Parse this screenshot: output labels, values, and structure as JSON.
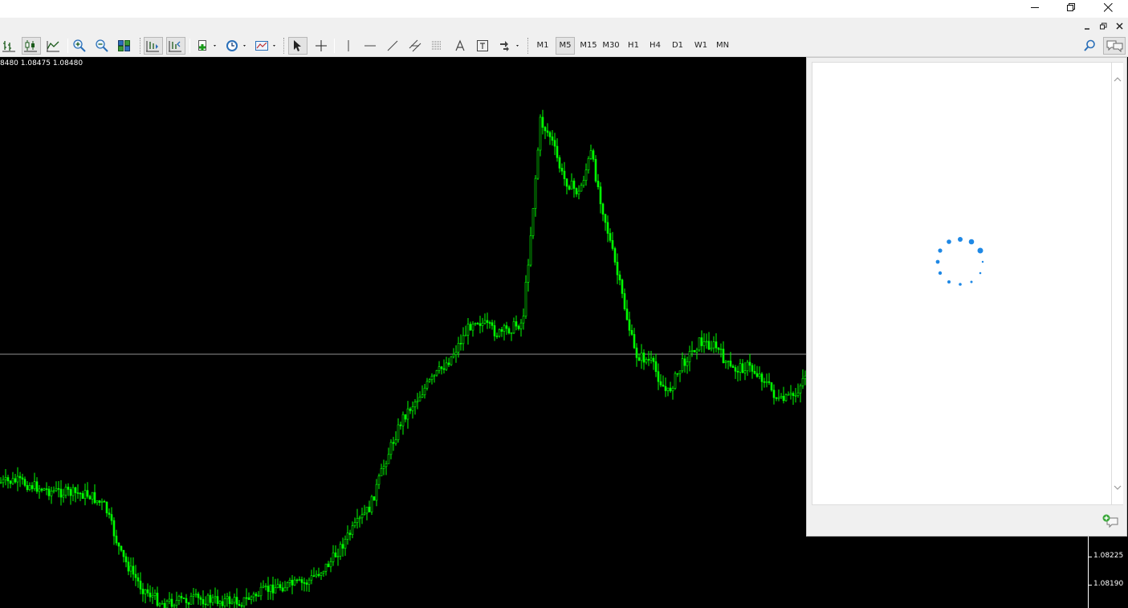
{
  "window": {
    "controls": [
      "minimize-icon",
      "restore-icon",
      "close-icon"
    ]
  },
  "mdi_controls": [
    "mdi-minimize-icon",
    "mdi-restore-icon",
    "mdi-close-icon"
  ],
  "toolbar": {
    "timeframes": [
      "M1",
      "M5",
      "M15",
      "M30",
      "H1",
      "H4",
      "D1",
      "W1",
      "MN"
    ],
    "active_timeframe": "M5",
    "tools": [
      "bar-chart-icon",
      "candlestick-chart-icon",
      "line-chart-icon",
      "zoom-in-icon",
      "zoom-out-icon",
      "tile-windows-icon",
      "autoscroll-icon",
      "chart-shift-icon",
      "indicators-icon",
      "periodicity-icon",
      "templates-icon",
      "cursor-icon",
      "crosshair-icon",
      "vertical-line-icon",
      "horizontal-line-icon",
      "trendline-icon",
      "equidistant-channel-icon",
      "fibonacci-icon",
      "text-icon",
      "text-label-icon",
      "arrows-icon"
    ],
    "right_icons": [
      "search-icon",
      "chat-icon"
    ]
  },
  "chart": {
    "info_text": "8480 1.08475 1.08480",
    "background": "#000000",
    "candle_color": "#00ff00",
    "grid_line_color": "#c0c0c0",
    "price_labels": [
      "1.08225",
      "1.08190"
    ]
  },
  "chat_panel": {
    "state": "loading",
    "spinner_color": "#1e88e5",
    "icons": [
      "scroll-up-icon",
      "scroll-down-icon",
      "add-chat-icon"
    ]
  },
  "colors": {
    "toolbar_bg": "#f0f0f0",
    "accent": "#1e88e5",
    "chart_bg": "#000000",
    "candle": "#00ff00"
  }
}
